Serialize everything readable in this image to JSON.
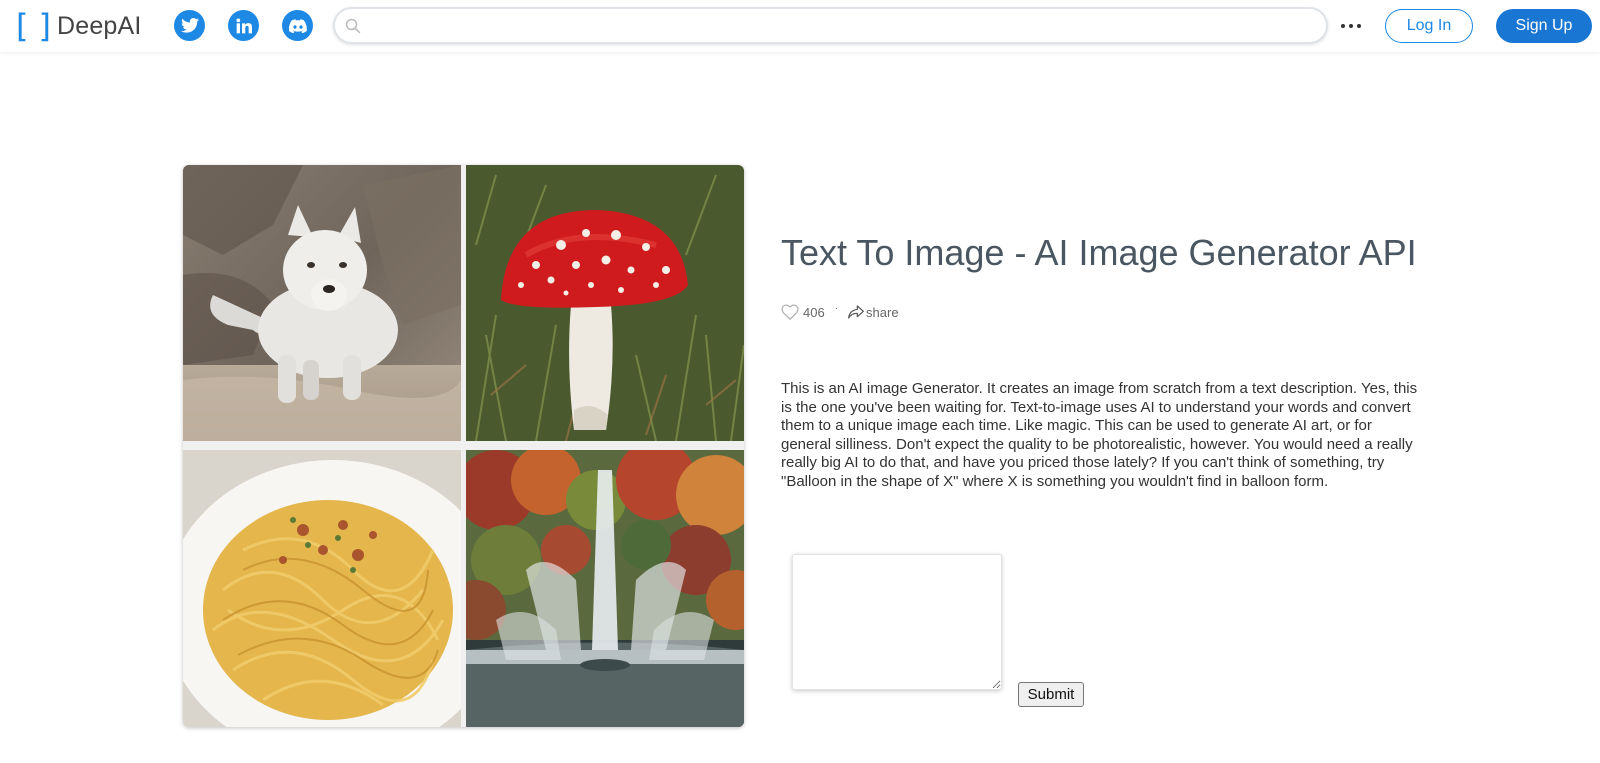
{
  "header": {
    "logo_text": "DeepAI",
    "logo_open_bracket": "[",
    "logo_close_bracket": "]",
    "social": [
      {
        "name": "twitter-icon",
        "color": "#1e88e5"
      },
      {
        "name": "linkedin-icon",
        "color": "#1e88e5"
      },
      {
        "name": "discord-icon",
        "color": "#1e88e5"
      }
    ],
    "search": {
      "placeholder": "",
      "value": ""
    },
    "more_icon": "ellipsis-icon",
    "login_label": "Log In",
    "signup_label": "Sign Up"
  },
  "gallery": {
    "images": [
      {
        "subject": "white wolf on rocks"
      },
      {
        "subject": "red fly agaric mushroom"
      },
      {
        "subject": "plate of spaghetti"
      },
      {
        "subject": "fountain with autumn trees"
      }
    ]
  },
  "main": {
    "title": "Text To Image - AI Image Generator API",
    "likes": "406",
    "separator": "·",
    "share_label": "share",
    "description": "This is an AI image Generator. It creates an image from scratch from a text description. Yes, this is the one you've been waiting for. Text-to-image uses AI to understand your words and convert them to a unique image each time. Like magic. This can be used to generate AI art, or for general silliness. Don't expect the quality to be photorealistic, however. You would need a really really big AI to do that, and have you priced those lately? If you can't think of something, try \"Balloon in the shape of X\" where X is something you wouldn't find in balloon form.",
    "prompt_value": "",
    "submit_label": "Submit"
  },
  "colors": {
    "accent": "#1e88e5",
    "signup_bg": "#1976d2",
    "title": "#4a5661"
  }
}
